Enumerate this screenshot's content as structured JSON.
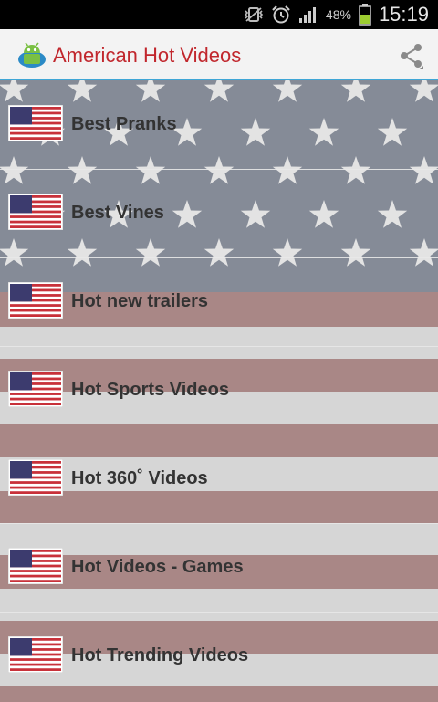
{
  "status_bar": {
    "battery_percent": "48%",
    "time": "15:19"
  },
  "action_bar": {
    "title": "American Hot Videos",
    "app_icon": "android-robot-icon",
    "share_icon": "share-icon"
  },
  "list": {
    "items": [
      {
        "label": "Best Pranks",
        "icon": "us-flag-icon"
      },
      {
        "label": "Best Vines",
        "icon": "us-flag-icon"
      },
      {
        "label": "Hot new trailers",
        "icon": "us-flag-icon"
      },
      {
        "label": "Hot Sports Videos",
        "icon": "us-flag-icon"
      },
      {
        "label": "Hot 360˚ Videos",
        "icon": "us-flag-icon"
      },
      {
        "label": "Hot Videos - Games",
        "icon": "us-flag-icon"
      },
      {
        "label": "Hot Trending Videos",
        "icon": "us-flag-icon"
      }
    ]
  },
  "colors": {
    "title_red": "#c1272d",
    "actionbar_divider": "#3fa6d6",
    "star_field": "#858b97",
    "stripe_red": "#a98786",
    "stripe_gray": "#d6d6d6"
  }
}
